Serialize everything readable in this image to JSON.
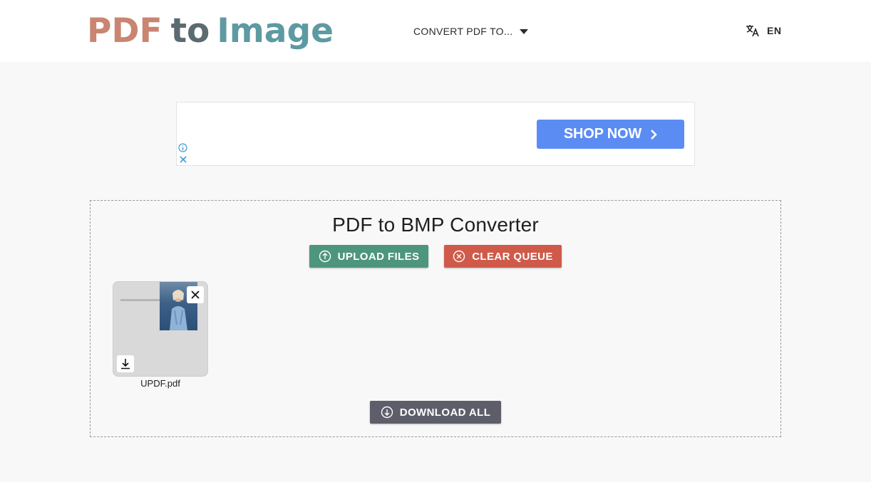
{
  "header": {
    "logo": {
      "part1": "PDF",
      "part2": "to",
      "part3": "Image"
    },
    "nav_convert_label": "CONVERT PDF TO...",
    "language_label": "EN"
  },
  "ad": {
    "button_label": "SHOP NOW"
  },
  "converter": {
    "title": "PDF to BMP Converter",
    "upload_label": "UPLOAD FILES",
    "clear_label": "CLEAR QUEUE",
    "download_all_label": "DOWNLOAD ALL",
    "files": [
      {
        "name": "UPDF.pdf"
      }
    ]
  },
  "colors": {
    "logo_pdf": "#c98571",
    "logo_to": "#5b6b70",
    "logo_image": "#5d9aa2",
    "upload_button": "#4e957d",
    "clear_button": "#cf5a4a",
    "download_button": "#5d5e6a",
    "shop_button": "#5b8cf4"
  },
  "icons": {
    "nav_caret": "caret-down-icon",
    "language": "translate-icon",
    "shop_chevron": "chevron-right-icon",
    "ad_info": "info-icon",
    "ad_close": "close-icon",
    "upload": "upload-circle-icon",
    "clear": "close-circle-icon",
    "remove_file": "close-icon",
    "download_file": "download-icon",
    "download_all": "download-circle-icon"
  }
}
